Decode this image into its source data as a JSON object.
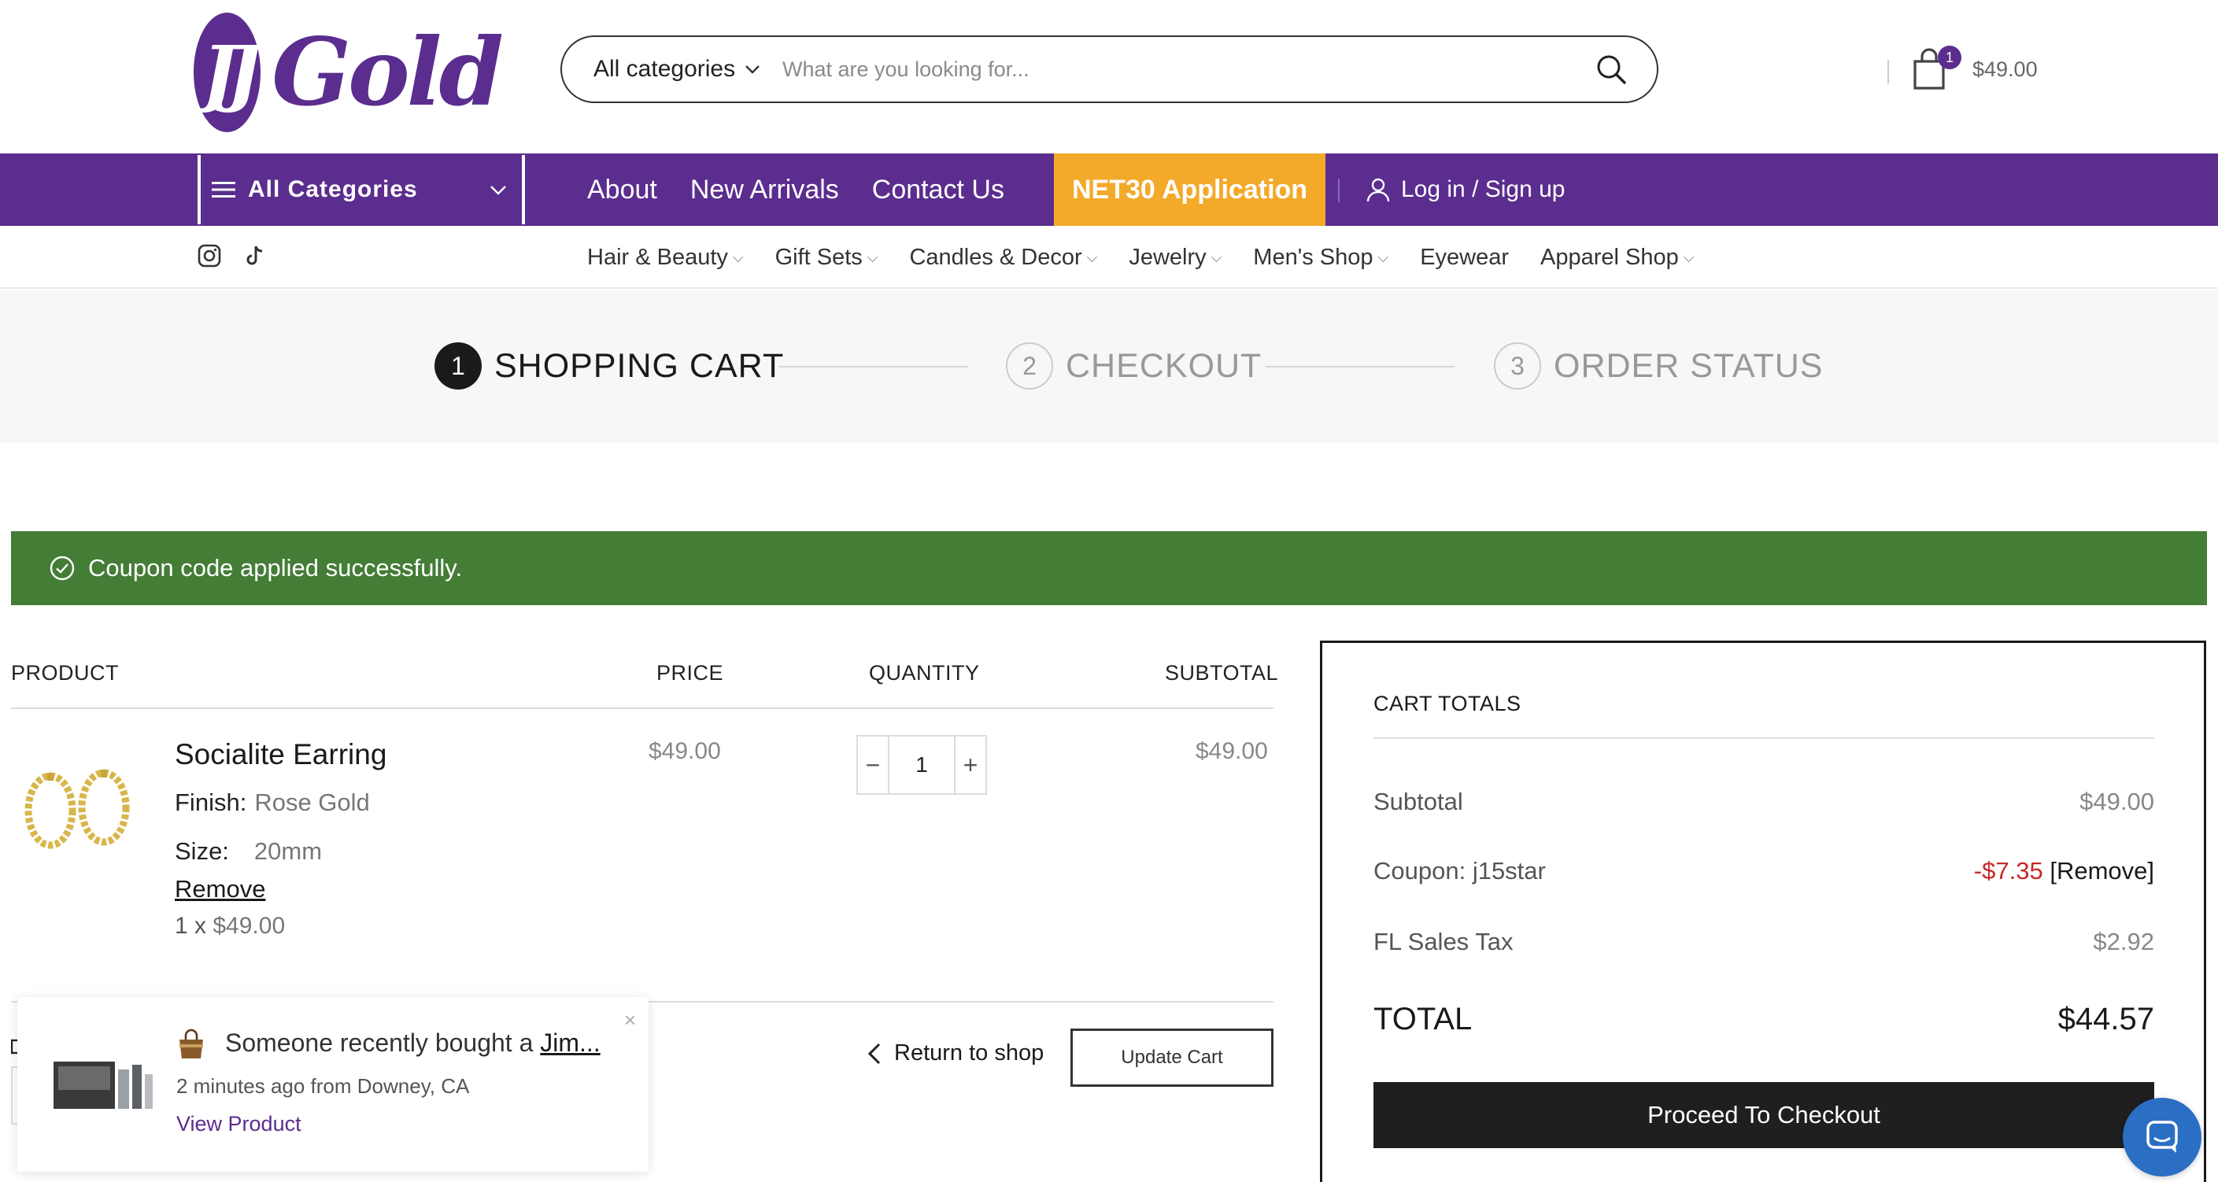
{
  "brand": {
    "logo_mark": "JJ",
    "logo_word": "Gold",
    "purple": "#5b2d8e",
    "orange": "#f3a929",
    "green": "#447d36"
  },
  "search": {
    "category": "All categories",
    "placeholder": "What are you looking for..."
  },
  "cart": {
    "count": "1",
    "amount": "$49.00"
  },
  "nav": {
    "all_categories": "All Categories",
    "links": [
      "About",
      "New Arrivals",
      "Contact Us"
    ],
    "net30": "NET30 Application",
    "login": "Log in / Sign up"
  },
  "subnav": {
    "links": [
      "Hair & Beauty",
      "Gift Sets",
      "Candles & Decor",
      "Jewelry",
      "Men's Shop",
      "Eyewear",
      "Apparel Shop"
    ],
    "chevron": "⌵"
  },
  "steps": [
    {
      "num": "1",
      "label": "SHOPPING CART"
    },
    {
      "num": "2",
      "label": "CHECKOUT"
    },
    {
      "num": "3",
      "label": "ORDER STATUS"
    }
  ],
  "notice": "Coupon code applied successfully.",
  "table": {
    "headers": {
      "product": "PRODUCT",
      "price": "PRICE",
      "quantity": "QUANTITY",
      "subtotal": "SUBTOTAL"
    },
    "item": {
      "name": "Socialite Earring",
      "finish_label": "Finish:",
      "finish_value": "Rose Gold",
      "size_label": "Size:",
      "size_value": "20mm",
      "remove": "Remove",
      "qty_prefix": "1 x",
      "qty_price": "$49.00",
      "price": "$49.00",
      "quantity": "1",
      "subtotal": "$49.00",
      "minus": "−",
      "plus": "+"
    },
    "return_shop": "Return to shop",
    "update_cart": "Update Cart"
  },
  "totals": {
    "title": "CART TOTALS",
    "subtotal_label": "Subtotal",
    "subtotal_value": "$49.00",
    "coupon_label": "Coupon: j15star",
    "coupon_value": "-$7.35",
    "coupon_remove": "[Remove]",
    "tax_label": "FL Sales Tax",
    "tax_value": "$2.92",
    "total_label": "TOTAL",
    "total_value": "$44.57",
    "checkout": "Proceed To Checkout"
  },
  "popup": {
    "close": "×",
    "title_prefix": "Someone recently bought a",
    "title_link": "Jim...",
    "time": "2 minutes ago from Downey, CA",
    "view": "View Product"
  }
}
